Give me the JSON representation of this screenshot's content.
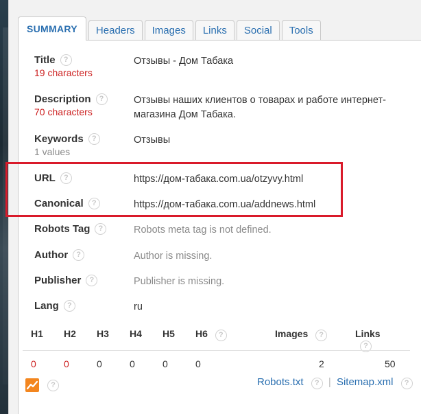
{
  "tabs": [
    {
      "label": "SUMMARY"
    },
    {
      "label": "Headers"
    },
    {
      "label": "Images"
    },
    {
      "label": "Links"
    },
    {
      "label": "Social"
    },
    {
      "label": "Tools"
    }
  ],
  "help_glyph": "?",
  "fields": {
    "title": {
      "label": "Title",
      "sub": "19 characters",
      "value": "Отзывы - Дом Табака"
    },
    "description": {
      "label": "Description",
      "sub": "70 characters",
      "value": "Отзывы наших клиентов о товарах и работе интернет-магазина Дом Табака."
    },
    "keywords": {
      "label": "Keywords",
      "sub": "1 values",
      "value": "Отзывы"
    },
    "url": {
      "label": "URL",
      "value": "https://дом-табака.com.ua/otzyvy.html"
    },
    "canonical": {
      "label": "Canonical",
      "value": "https://дом-табака.com.ua/addnews.html"
    },
    "robots": {
      "label": "Robots Tag",
      "value": "Robots meta tag is not defined."
    },
    "author": {
      "label": "Author",
      "value": "Author is missing."
    },
    "publisher": {
      "label": "Publisher",
      "value": "Publisher is missing."
    },
    "lang": {
      "label": "Lang",
      "value": "ru"
    }
  },
  "headings": {
    "columns": [
      "H1",
      "H2",
      "H3",
      "H4",
      "H5",
      "H6",
      "Images",
      "Links"
    ],
    "values": [
      "0",
      "0",
      "0",
      "0",
      "0",
      "0",
      "2",
      "50"
    ]
  },
  "bottom": {
    "robots_link": "Robots.txt",
    "sitemap_link": "Sitemap.xml",
    "separator": "|"
  },
  "colors": {
    "accent": "#2a6fb0",
    "warning": "#cc1f1f",
    "highlight_box": "#d91a2a",
    "chart_icon": "#f3861f"
  }
}
